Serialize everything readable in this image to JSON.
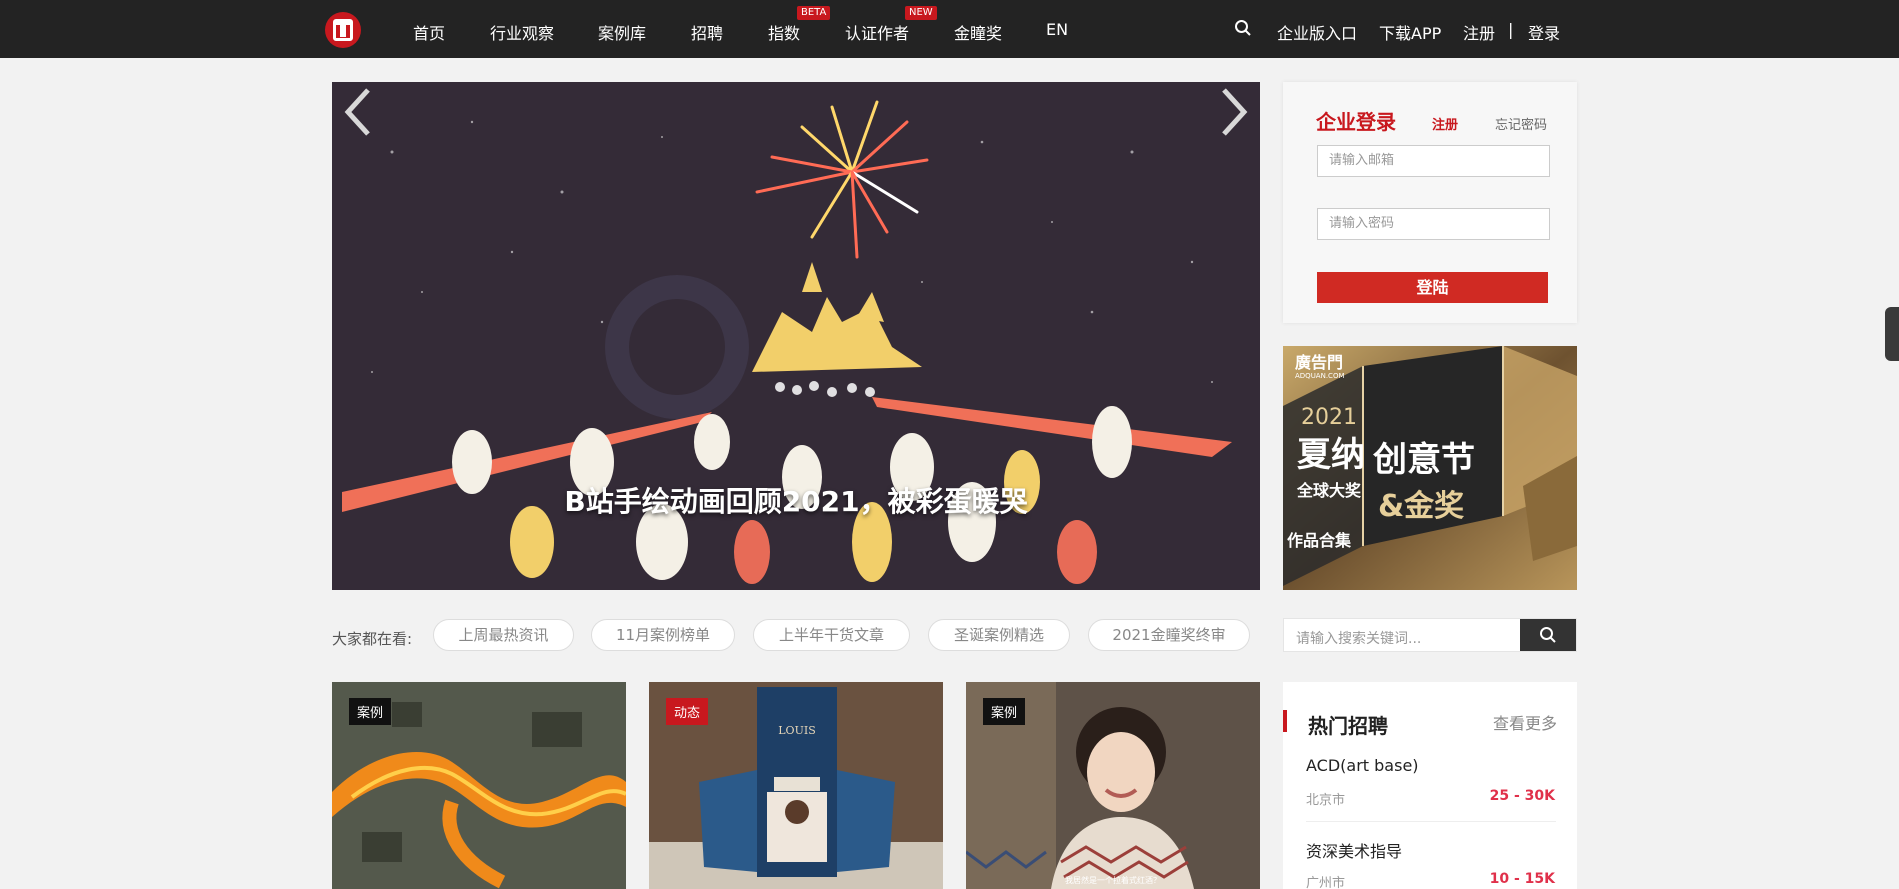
{
  "nav": {
    "items": [
      "首页",
      "行业观察",
      "案例库",
      "招聘",
      "指数",
      "认证作者",
      "金瞳奖",
      "EN"
    ],
    "badge_beta": "BETA",
    "badge_new": "NEW",
    "enterprise": "企业版入口",
    "download": "下载APP",
    "register": "注册",
    "separator": "|",
    "login": "登录"
  },
  "banner": {
    "caption": "B站手绘动画回顾2021，被彩蛋暖哭"
  },
  "login": {
    "title": "企业登录",
    "register": "注册",
    "forgot": "忘记密码",
    "email_placeholder": "请输入邮箱",
    "password_placeholder": "请输入密码",
    "submit": "登陆"
  },
  "ad": {
    "brand": "廣告門",
    "brand_sub": "ADQUAN.COM",
    "year": "2021",
    "line1": "夏纳",
    "line2": "创意节",
    "line3": "全球大奖",
    "line4": "&金奖",
    "line5": "作品合集"
  },
  "tags": {
    "label": "大家都在看:",
    "items": [
      "上周最热资讯",
      "11月案例榜单",
      "上半年干货文章",
      "圣诞案例精选",
      "2021金瞳奖终审"
    ]
  },
  "search": {
    "placeholder": "请输入搜索关键词..."
  },
  "cards": [
    {
      "badge": "案例",
      "badge_color": "#111111"
    },
    {
      "badge": "动态",
      "badge_color": "#c8181e",
      "sign_text": "LOUIS"
    },
    {
      "badge": "案例",
      "badge_color": "#111111",
      "subtitle": "我居然是一个拉着式红酒？"
    }
  ],
  "jobs": {
    "title": "热门招聘",
    "more": "查看更多",
    "list": [
      {
        "name": "ACD(art base)",
        "city": "北京市",
        "salary": "25 - 30K"
      },
      {
        "name": "资深美术指导",
        "city": "广州市",
        "salary": "10 - 15K"
      }
    ]
  },
  "colors": {
    "accent": "#c8181e",
    "nav_bg": "#232323",
    "salary": "#e0304a"
  }
}
